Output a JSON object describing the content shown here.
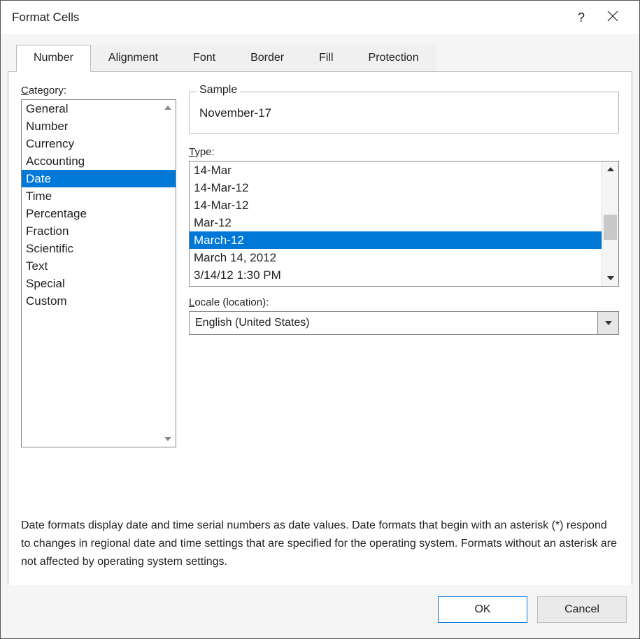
{
  "window": {
    "title": "Format Cells",
    "help": "?",
    "close": "×"
  },
  "tabs": [
    {
      "label": "Number",
      "active": true
    },
    {
      "label": "Alignment",
      "active": false
    },
    {
      "label": "Font",
      "active": false
    },
    {
      "label": "Border",
      "active": false
    },
    {
      "label": "Fill",
      "active": false
    },
    {
      "label": "Protection",
      "active": false
    }
  ],
  "labels": {
    "category": "Category:",
    "sample": "Sample",
    "type": "Type:",
    "locale": "Locale (location):"
  },
  "categories": [
    {
      "label": "General",
      "selected": false
    },
    {
      "label": "Number",
      "selected": false
    },
    {
      "label": "Currency",
      "selected": false
    },
    {
      "label": "Accounting",
      "selected": false
    },
    {
      "label": "Date",
      "selected": true
    },
    {
      "label": "Time",
      "selected": false
    },
    {
      "label": "Percentage",
      "selected": false
    },
    {
      "label": "Fraction",
      "selected": false
    },
    {
      "label": "Scientific",
      "selected": false
    },
    {
      "label": "Text",
      "selected": false
    },
    {
      "label": "Special",
      "selected": false
    },
    {
      "label": "Custom",
      "selected": false
    }
  ],
  "sample_value": "November-17",
  "types": [
    {
      "label": "14-Mar",
      "selected": false
    },
    {
      "label": "14-Mar-12",
      "selected": false
    },
    {
      "label": "14-Mar-12",
      "selected": false
    },
    {
      "label": "Mar-12",
      "selected": false
    },
    {
      "label": "March-12",
      "selected": true
    },
    {
      "label": "March 14, 2012",
      "selected": false
    },
    {
      "label": "3/14/12 1:30 PM",
      "selected": false
    }
  ],
  "locale_value": "English (United States)",
  "description": "Date formats display date and time serial numbers as date values.  Date formats that begin with an asterisk (*) respond to changes in regional date and time settings that are specified for the operating system. Formats without an asterisk are not affected by operating system settings.",
  "buttons": {
    "ok": "OK",
    "cancel": "Cancel"
  }
}
